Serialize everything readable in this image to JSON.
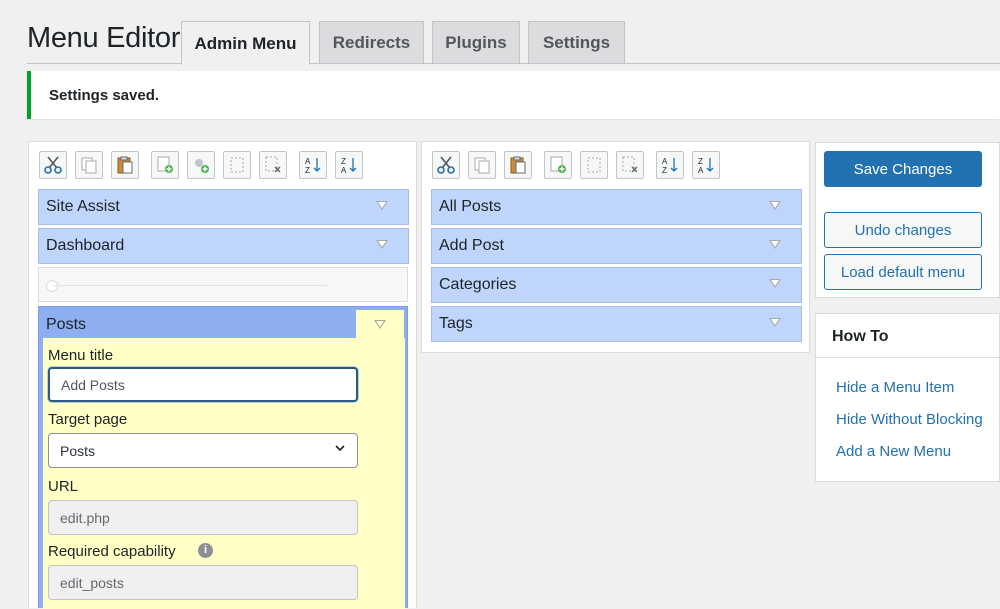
{
  "header": {
    "title": "Menu Editor",
    "tabs": [
      {
        "label": "Admin Menu",
        "active": true
      },
      {
        "label": "Redirects",
        "active": false
      },
      {
        "label": "Plugins",
        "active": false
      },
      {
        "label": "Settings",
        "active": false
      }
    ]
  },
  "notice": {
    "text": "Settings saved.",
    "color": "#00a32a"
  },
  "toolbar_left": [
    "cut-icon",
    "copy-icon",
    "paste-icon",
    "new-menu-icon",
    "new-separator-icon",
    "duplicate-icon",
    "delete-icon",
    "sort-ascending-icon",
    "sort-descending-icon"
  ],
  "toolbar_right": [
    "cut-icon",
    "copy-icon",
    "paste-icon",
    "new-item-icon",
    "duplicate-icon",
    "delete-icon",
    "sort-ascending-icon",
    "sort-descending-icon"
  ],
  "left_menu": {
    "items": [
      "Site Assist",
      "Dashboard"
    ],
    "expanded_item": {
      "label": "Posts",
      "fields": {
        "menu_title_label": "Menu title",
        "menu_title_value": "Add Posts",
        "target_page_label": "Target page",
        "target_page_value": "Posts",
        "url_label": "URL",
        "url_value": "edit.php",
        "capability_label": "Required capability",
        "capability_value": "edit_posts"
      }
    }
  },
  "right_menu": {
    "items": [
      "All Posts",
      "Add Post",
      "Categories",
      "Tags"
    ]
  },
  "actions": {
    "save": "Save Changes",
    "undo": "Undo changes",
    "load_default": "Load default menu"
  },
  "howto": {
    "title": "How To",
    "links": [
      "Hide a Menu Item",
      "Hide Without Blocking",
      "Add a New Menu"
    ]
  },
  "colors": {
    "accent": "#2271b1",
    "item_bg": "#c0d5fb",
    "selected_item_bg": "#8eaef2",
    "editor_bg": "#ffffc6"
  }
}
